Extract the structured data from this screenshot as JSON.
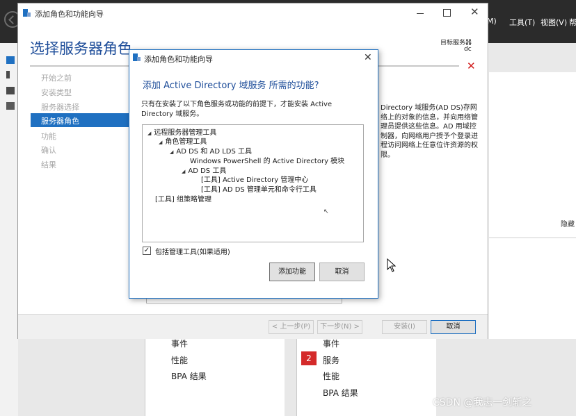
{
  "server_manager": {
    "menu": [
      {
        "label": "M)"
      },
      {
        "label": "工具(T)"
      },
      {
        "label": "视图(V)"
      },
      {
        "label": "帮"
      }
    ],
    "hide_label": "隐藏",
    "tiles": [
      {
        "items": [
          "事件",
          "性能",
          "BPA 结果"
        ]
      },
      {
        "badge": "2",
        "items": [
          "事件",
          "服务",
          "性能",
          "BPA 结果"
        ]
      }
    ]
  },
  "wizard": {
    "title": "添加角色和功能向导",
    "heading": "选择服务器角色",
    "destination_label": "目标服务器",
    "destination_value": "dc",
    "steps": [
      "开始之前",
      "安装类型",
      "服务器选择",
      "服务器角色",
      "功能",
      "确认",
      "结果"
    ],
    "active_step_index": 3,
    "description": "Directory 域服务(AD DS)存网络上的对象的信息，并向用络管理员提供这些信息。AD 用域控制器，向网络用户授予个登录进程访问网络上任意位许资源的权限。",
    "buttons": {
      "prev": "< 上一步(P)",
      "next": "下一步(N) >",
      "install": "安装(I)",
      "cancel": "取消"
    }
  },
  "dialog": {
    "title": "添加角色和功能向导",
    "heading": "添加 Active Directory 域服务 所需的功能?",
    "description": "只有在安装了以下角色服务或功能的前提下，才能安装 Active Directory 域服务。",
    "tree": [
      {
        "label": "远程服务器管理工具",
        "level": 0,
        "expanded": true
      },
      {
        "label": "角色管理工具",
        "level": 1,
        "expanded": true
      },
      {
        "label": "AD DS 和 AD LDS 工具",
        "level": 2,
        "expanded": true
      },
      {
        "label": "Windows PowerShell 的 Active Directory 模块",
        "level": 3,
        "expanded": false
      },
      {
        "label": "AD DS 工具",
        "level": 3,
        "expanded": true
      },
      {
        "label": "[工具] Active Directory 管理中心",
        "level": 4,
        "expanded": false
      },
      {
        "label": "[工具] AD DS 管理单元和命令行工具",
        "level": 4,
        "expanded": false
      },
      {
        "label": "[工具] 组策略管理",
        "level": 0,
        "expanded": false
      }
    ],
    "checkbox": {
      "label": "包括管理工具(如果适用)",
      "checked": true
    },
    "buttons": {
      "add": "添加功能",
      "cancel": "取消"
    }
  },
  "watermark": "CSDN @我志一剑斩之",
  "colors": {
    "accent": "#1f70c1",
    "heading": "#1f4e9a",
    "error": "#d01818"
  }
}
